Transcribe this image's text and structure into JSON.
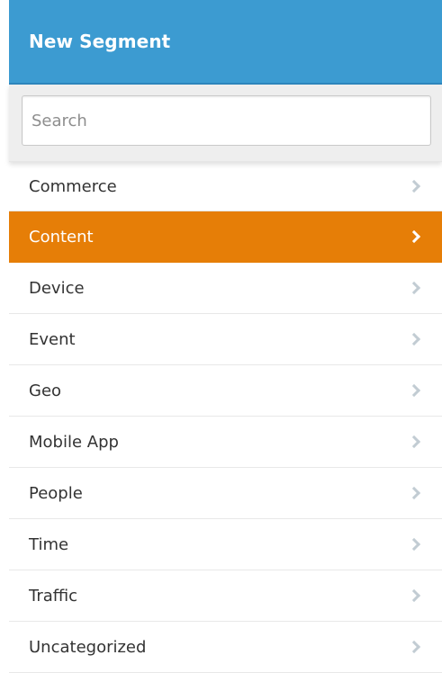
{
  "header": {
    "title": "New Segment"
  },
  "search": {
    "placeholder": "Search",
    "value": ""
  },
  "categories": [
    {
      "label": "Commerce",
      "active": false
    },
    {
      "label": "Content",
      "active": true
    },
    {
      "label": "Device",
      "active": false
    },
    {
      "label": "Event",
      "active": false
    },
    {
      "label": "Geo",
      "active": false
    },
    {
      "label": "Mobile App",
      "active": false
    },
    {
      "label": "People",
      "active": false
    },
    {
      "label": "Time",
      "active": false
    },
    {
      "label": "Traffic",
      "active": false
    },
    {
      "label": "Uncategorized",
      "active": false
    }
  ],
  "icons": {
    "item_chevron": "chevron-right-icon"
  },
  "colors": {
    "header_bg": "#3c9bd1",
    "active_bg": "#e67e07",
    "chevron": "#c2ccd3"
  }
}
